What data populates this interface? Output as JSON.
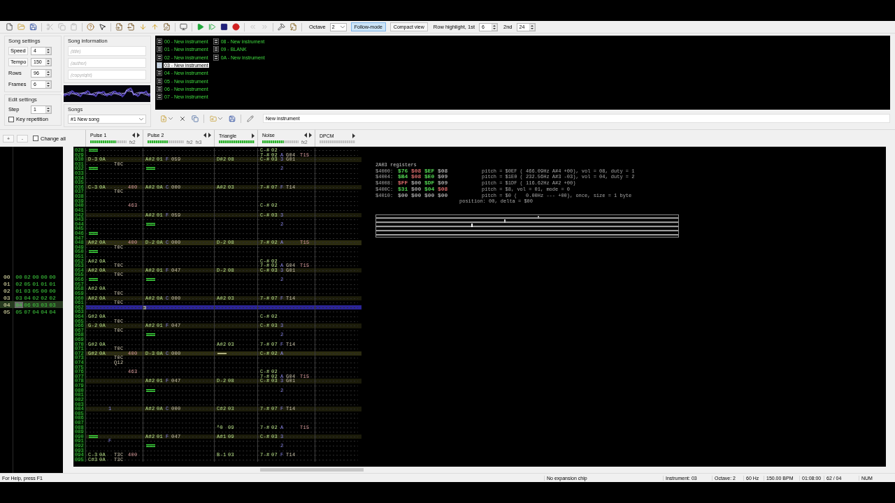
{
  "toolbar": {
    "buttons": [
      {
        "kind": "new",
        "disabled": false
      },
      {
        "kind": "open",
        "disabled": false
      },
      {
        "kind": "save",
        "disabled": false
      },
      {
        "kind": "cut",
        "disabled": true
      },
      {
        "kind": "copy",
        "disabled": true
      },
      {
        "kind": "paste",
        "disabled": true
      },
      {
        "kind": "help",
        "disabled": false
      },
      {
        "kind": "context-help",
        "disabled": false
      },
      {
        "kind": "import",
        "disabled": false
      },
      {
        "kind": "export",
        "disabled": false
      },
      {
        "kind": "move-down",
        "disabled": false
      },
      {
        "kind": "move-up",
        "disabled": false
      },
      {
        "kind": "edit",
        "disabled": false
      },
      {
        "kind": "properties",
        "disabled": false
      },
      {
        "kind": "play",
        "disabled": false
      },
      {
        "kind": "play-pattern",
        "disabled": false
      },
      {
        "kind": "stop",
        "disabled": false
      },
      {
        "kind": "record",
        "disabled": false
      },
      {
        "kind": "previous-song",
        "disabled": true
      },
      {
        "kind": "next-song",
        "disabled": true
      },
      {
        "kind": "settings",
        "disabled": false
      },
      {
        "kind": "nsf",
        "disabled": false
      }
    ],
    "octave_label": "Octave",
    "octave": "2",
    "follow_mode": {
      "label": "Follow-mode",
      "on": true
    },
    "compact_view": {
      "label": "Compact view",
      "on": false
    },
    "row_highlight_label": "Row highlight, 1st",
    "row_highlight_1st": "6",
    "second_label": "2nd",
    "row_highlight_2nd": "24"
  },
  "song_settings": {
    "title": "Song settings",
    "fields": [
      {
        "label": "Speed",
        "kind": "button",
        "value": "4"
      },
      {
        "label": "Tempo",
        "kind": "button",
        "value": "150"
      },
      {
        "label": "Rows",
        "kind": "label",
        "value": "96"
      },
      {
        "label": "Frames",
        "kind": "label",
        "value": "6"
      }
    ]
  },
  "edit_settings": {
    "title": "Edit settings",
    "step_label": "Step",
    "step": "1",
    "key_repetition": {
      "label": "Key repetition",
      "checked": false
    }
  },
  "song_information": {
    "title": "Song information",
    "fields": [
      {
        "placeholder": "(title)"
      },
      {
        "placeholder": "(author)"
      },
      {
        "placeholder": "(copyright)"
      }
    ]
  },
  "songs": {
    "title": "Songs",
    "value": "#1 New song"
  },
  "instruments": [
    {
      "label": "00 - New instrument",
      "selected": false
    },
    {
      "label": "01 - New instrument",
      "selected": false
    },
    {
      "label": "02 - New instrument",
      "selected": false
    },
    {
      "label": "03 - New instrument",
      "selected": true
    },
    {
      "label": "04 - New instrument",
      "selected": false
    },
    {
      "label": "05 - New instrument",
      "selected": false
    },
    {
      "label": "06 - New instrument",
      "selected": false
    },
    {
      "label": "07 - New instrument",
      "selected": false
    },
    {
      "label": "08 - New instrument",
      "selected": false
    },
    {
      "label": "09 - BLANK",
      "selected": false
    },
    {
      "label": "0A - New instrument",
      "selected": false
    }
  ],
  "instrument_toolbar": {
    "buttons": [
      {
        "kind": "new",
        "has_menu": true
      },
      {
        "kind": "remove",
        "has_menu": false
      },
      {
        "kind": "clone",
        "has_menu": false
      },
      {
        "kind": "load",
        "has_menu": true
      },
      {
        "kind": "save",
        "has_menu": false
      },
      {
        "kind": "edit",
        "has_menu": false
      }
    ],
    "name": "New instrument"
  },
  "frame_controls": {
    "add": "+",
    "remove": "-",
    "change_all": {
      "label": "Change all",
      "checked": false
    }
  },
  "frames": [
    {
      "number": "00",
      "patterns": [
        "00",
        "02",
        "00",
        "00",
        "00"
      ],
      "selected": false
    },
    {
      "number": "01",
      "patterns": [
        "02",
        "05",
        "01",
        "01",
        "01"
      ],
      "selected": false
    },
    {
      "number": "02",
      "patterns": [
        "01",
        "03",
        "05",
        "00",
        "00"
      ],
      "selected": false
    },
    {
      "number": "03",
      "patterns": [
        "03",
        "04",
        "02",
        "02",
        "02"
      ],
      "selected": false
    },
    {
      "number": "04",
      "patterns": [
        "04",
        "06",
        "03",
        "03",
        "03"
      ],
      "selected": true
    },
    {
      "number": "05",
      "patterns": [
        "05",
        "07",
        "04",
        "04",
        "04"
      ],
      "selected": false
    }
  ],
  "channels": [
    {
      "name": "Pulse 1",
      "level": 0.72,
      "fx_labels": [
        "fx2"
      ],
      "kind": "two-arrows"
    },
    {
      "name": "Pulse 2",
      "level": 0.55,
      "fx_labels": [
        "fx2",
        "fx3"
      ],
      "kind": "two-arrows"
    },
    {
      "name": "Triangle",
      "level": 1,
      "kind": "one-arrow"
    },
    {
      "name": "Noise",
      "level": 0.6,
      "fx_labels": [
        "fx2"
      ],
      "kind": "two-arrows"
    },
    {
      "name": "DPCM",
      "kind": "one-arrow"
    }
  ],
  "pattern_rows": [
    {
      "number": "028",
      "selected": false,
      "kind": "plain",
      "cells": [
        {
          "kind": "note-off"
        },
        {
          "kind": "empty"
        },
        {
          "kind": "empty"
        },
        {
          "kind": "entry",
          "note": "C-#",
          "inst": "02"
        }
      ]
    },
    {
      "number": "029",
      "selected": false,
      "kind": "plain",
      "cells": [
        {
          "kind": "empty"
        },
        {
          "kind": "empty"
        },
        {
          "kind": "empty"
        },
        {
          "kind": "entry",
          "note": "7-#",
          "inst": "02",
          "vol": "A",
          "fx1": "G04",
          "fx2": "T15"
        }
      ]
    },
    {
      "number": "030",
      "selected": false,
      "kind": "minor",
      "cells": [
        {
          "kind": "entry",
          "note": "D-3",
          "inst": "0A"
        },
        {
          "kind": "entry",
          "note": "A#2",
          "inst": "01",
          "vol": "F",
          "fx1": "059"
        },
        {
          "kind": "entry",
          "note": "D#2",
          "inst": "08"
        },
        {
          "kind": "entry",
          "note": "C-#",
          "inst": "03",
          "vol": "3",
          "fx1": "G01"
        }
      ]
    },
    {
      "number": "031",
      "selected": false,
      "kind": "plain",
      "cells": [
        {
          "kind": "entry",
          "fx1": "T0C"
        }
      ]
    },
    {
      "number": "032",
      "selected": false,
      "kind": "plain",
      "cells": [
        {
          "kind": "note-off"
        },
        {
          "kind": "note-off"
        },
        {
          "kind": "empty"
        },
        {
          "kind": "entry",
          "vol": "2"
        }
      ]
    },
    {
      "number": "033",
      "selected": false,
      "kind": "plain"
    },
    {
      "number": "034",
      "selected": false,
      "kind": "plain"
    },
    {
      "number": "035",
      "selected": false,
      "kind": "plain"
    },
    {
      "number": "036",
      "selected": false,
      "kind": "minor",
      "cells": [
        {
          "kind": "entry",
          "note": "C-3",
          "inst": "0A",
          "fx2": "400"
        },
        {
          "kind": "entry",
          "note": "A#2",
          "inst": "0A",
          "vol": "C",
          "fx1": "000"
        },
        {
          "kind": "entry",
          "note": "A#2",
          "inst": "03"
        },
        {
          "kind": "entry",
          "note": "7-#",
          "inst": "07",
          "vol": "F",
          "fx1": "T14"
        }
      ]
    },
    {
      "number": "037",
      "selected": false,
      "kind": "plain",
      "cells": [
        {
          "kind": "entry",
          "fx1": "T0C"
        }
      ]
    },
    {
      "number": "038",
      "selected": false,
      "kind": "plain"
    },
    {
      "number": "039",
      "selected": false,
      "kind": "plain"
    },
    {
      "number": "040",
      "selected": false,
      "kind": "plain",
      "cells": [
        {
          "kind": "entry",
          "fx2": "463"
        },
        {
          "kind": "empty"
        },
        {
          "kind": "empty"
        },
        {
          "kind": "entry",
          "note": "C-#",
          "inst": "02"
        }
      ]
    },
    {
      "number": "041",
      "selected": false,
      "kind": "plain"
    },
    {
      "number": "042",
      "selected": false,
      "kind": "minor",
      "cells": [
        {
          "kind": "empty"
        },
        {
          "kind": "entry",
          "note": "A#2",
          "inst": "01",
          "vol": "F",
          "fx1": "059"
        },
        {
          "kind": "empty"
        },
        {
          "kind": "entry",
          "note": "C-#",
          "inst": "03",
          "vol": "3"
        }
      ]
    },
    {
      "number": "043",
      "selected": false,
      "kind": "plain"
    },
    {
      "number": "044",
      "selected": false,
      "kind": "plain",
      "cells": [
        {
          "kind": "empty"
        },
        {
          "kind": "note-off"
        },
        {
          "kind": "empty"
        },
        {
          "kind": "entry",
          "vol": "2"
        }
      ]
    },
    {
      "number": "045",
      "selected": false,
      "kind": "plain"
    },
    {
      "number": "046",
      "selected": false,
      "kind": "plain",
      "cells": [
        {
          "kind": "note-off"
        }
      ]
    },
    {
      "number": "047",
      "selected": false,
      "kind": "plain"
    },
    {
      "number": "048",
      "selected": false,
      "kind": "major",
      "cells": [
        {
          "kind": "entry",
          "note": "A#2",
          "inst": "0A",
          "fx2": "400"
        },
        {
          "kind": "entry",
          "note": "D-2",
          "inst": "0A",
          "vol": "C",
          "fx1": "000"
        },
        {
          "kind": "entry",
          "note": "D-2",
          "inst": "08"
        },
        {
          "kind": "entry",
          "note": "7-#",
          "inst": "02",
          "vol": "A",
          "fx2": "T15"
        }
      ]
    },
    {
      "number": "049",
      "selected": false,
      "kind": "plain",
      "cells": [
        {
          "kind": "entry",
          "fx1": "T0C"
        }
      ]
    },
    {
      "number": "050",
      "selected": false,
      "kind": "plain",
      "cells": [
        {
          "kind": "note-off"
        }
      ]
    },
    {
      "number": "051",
      "selected": false,
      "kind": "plain"
    },
    {
      "number": "052",
      "selected": false,
      "kind": "plain",
      "cells": [
        {
          "kind": "entry",
          "note": "A#2",
          "inst": "0A"
        },
        {
          "kind": "empty"
        },
        {
          "kind": "empty"
        },
        {
          "kind": "entry",
          "note": "C-#",
          "inst": "02"
        }
      ]
    },
    {
      "number": "053",
      "selected": false,
      "kind": "plain",
      "cells": [
        {
          "kind": "entry",
          "fx1": "T0C"
        },
        {
          "kind": "empty"
        },
        {
          "kind": "empty"
        },
        {
          "kind": "entry",
          "note": "7-#",
          "inst": "02",
          "vol": "A",
          "fx1": "G04",
          "fx2": "T15"
        }
      ]
    },
    {
      "number": "054",
      "selected": false,
      "kind": "minor",
      "cells": [
        {
          "kind": "entry",
          "note": "A#2",
          "inst": "0A"
        },
        {
          "kind": "entry",
          "note": "A#2",
          "inst": "01",
          "vol": "F",
          "fx1": "047"
        },
        {
          "kind": "entry",
          "note": "D-2",
          "inst": "08"
        },
        {
          "kind": "entry",
          "note": "C-#",
          "inst": "03",
          "vol": "3",
          "fx1": "G01"
        }
      ]
    },
    {
      "number": "055",
      "selected": false,
      "kind": "plain",
      "cells": [
        {
          "kind": "entry",
          "fx1": "T0C"
        }
      ]
    },
    {
      "number": "056",
      "selected": false,
      "kind": "plain",
      "cells": [
        {
          "kind": "note-off"
        },
        {
          "kind": "note-off"
        },
        {
          "kind": "empty"
        },
        {
          "kind": "entry",
          "vol": "2"
        }
      ]
    },
    {
      "number": "057",
      "selected": false,
      "kind": "plain"
    },
    {
      "number": "058",
      "selected": false,
      "kind": "plain",
      "cells": [
        {
          "kind": "entry",
          "note": "A#2",
          "inst": "0A"
        }
      ]
    },
    {
      "number": "059",
      "selected": false,
      "kind": "plain",
      "cells": [
        {
          "kind": "entry",
          "fx1": "T0C"
        }
      ]
    },
    {
      "number": "060",
      "selected": false,
      "kind": "minor",
      "cells": [
        {
          "kind": "entry",
          "note": "A#2",
          "inst": "0A"
        },
        {
          "kind": "entry",
          "note": "A#2",
          "inst": "0A",
          "vol": "C",
          "fx1": "000"
        },
        {
          "kind": "entry",
          "note": "A#2",
          "inst": "03"
        },
        {
          "kind": "entry",
          "note": "7-#",
          "inst": "07",
          "vol": "F",
          "fx1": "T14"
        }
      ]
    },
    {
      "number": "061",
      "selected": false,
      "kind": "plain",
      "cells": [
        {
          "kind": "entry",
          "fx1": "T0C"
        }
      ]
    },
    {
      "number": "062",
      "selected": true,
      "kind": "plain"
    },
    {
      "number": "063",
      "selected": false,
      "kind": "plain"
    },
    {
      "number": "064",
      "selected": false,
      "kind": "plain",
      "cells": [
        {
          "kind": "entry",
          "note": "G#2",
          "inst": "0A"
        },
        {
          "kind": "empty"
        },
        {
          "kind": "empty"
        },
        {
          "kind": "entry",
          "note": "C-#",
          "inst": "02"
        }
      ]
    },
    {
      "number": "065",
      "selected": false,
      "kind": "plain",
      "cells": [
        {
          "kind": "entry",
          "fx1": "T0C"
        }
      ]
    },
    {
      "number": "066",
      "selected": false,
      "kind": "minor",
      "cells": [
        {
          "kind": "entry",
          "note": "G-2",
          "inst": "0A"
        },
        {
          "kind": "entry",
          "note": "A#2",
          "inst": "01",
          "vol": "F",
          "fx1": "047"
        },
        {
          "kind": "empty"
        },
        {
          "kind": "entry",
          "note": "C-#",
          "inst": "03",
          "vol": "3"
        }
      ]
    },
    {
      "number": "067",
      "selected": false,
      "kind": "plain",
      "cells": [
        {
          "kind": "entry",
          "fx1": "T0C"
        }
      ]
    },
    {
      "number": "068",
      "selected": false,
      "kind": "plain",
      "cells": [
        {
          "kind": "empty"
        },
        {
          "kind": "note-off"
        },
        {
          "kind": "empty"
        },
        {
          "kind": "entry",
          "vol": "2"
        }
      ]
    },
    {
      "number": "069",
      "selected": false,
      "kind": "plain"
    },
    {
      "number": "070",
      "selected": false,
      "kind": "plain",
      "cells": [
        {
          "kind": "entry",
          "note": "G#2",
          "inst": "0A"
        },
        {
          "kind": "empty"
        },
        {
          "kind": "entry",
          "note": "A#2",
          "inst": "03"
        },
        {
          "kind": "entry",
          "note": "7-#",
          "inst": "07",
          "vol": "F",
          "fx1": "T14"
        }
      ]
    },
    {
      "number": "071",
      "selected": false,
      "kind": "plain",
      "cells": [
        {
          "kind": "entry",
          "fx1": "T0C"
        }
      ]
    },
    {
      "number": "072",
      "selected": false,
      "kind": "major",
      "cells": [
        {
          "kind": "entry",
          "note": "G#2",
          "inst": "0A",
          "fx2": "400"
        },
        {
          "kind": "entry",
          "note": "D-3",
          "inst": "0A",
          "vol": "C",
          "fx1": "000"
        },
        {
          "kind": "release"
        },
        {
          "kind": "entry",
          "note": "C-#",
          "inst": "02",
          "vol": "A"
        }
      ]
    },
    {
      "number": "073",
      "selected": false,
      "kind": "plain",
      "cells": [
        {
          "kind": "entry",
          "fx1": "T0C"
        }
      ]
    },
    {
      "number": "074",
      "selected": false,
      "kind": "plain",
      "cells": [
        {
          "kind": "entry",
          "fx1": "Q12"
        }
      ]
    },
    {
      "number": "075",
      "selected": false,
      "kind": "plain"
    },
    {
      "number": "076",
      "selected": false,
      "kind": "plain",
      "cells": [
        {
          "kind": "entry",
          "fx2": "463"
        },
        {
          "kind": "empty"
        },
        {
          "kind": "empty"
        },
        {
          "kind": "entry",
          "note": "C-#",
          "inst": "02"
        }
      ]
    },
    {
      "number": "077",
      "selected": false,
      "kind": "plain",
      "cells": [
        {
          "kind": "empty"
        },
        {
          "kind": "empty"
        },
        {
          "kind": "empty"
        },
        {
          "kind": "entry",
          "note": "7-#",
          "inst": "02",
          "vol": "A",
          "fx1": "G04",
          "fx2": "T15"
        }
      ]
    },
    {
      "number": "078",
      "selected": false,
      "kind": "minor",
      "cells": [
        {
          "kind": "empty"
        },
        {
          "kind": "entry",
          "note": "A#2",
          "inst": "01",
          "vol": "F",
          "fx1": "047"
        },
        {
          "kind": "entry",
          "note": "D-2",
          "inst": "08"
        },
        {
          "kind": "entry",
          "note": "C-#",
          "inst": "03",
          "vol": "3",
          "fx1": "G01"
        }
      ]
    },
    {
      "number": "079",
      "selected": false,
      "kind": "plain"
    },
    {
      "number": "080",
      "selected": false,
      "kind": "plain",
      "cells": [
        {
          "kind": "empty"
        },
        {
          "kind": "note-off"
        },
        {
          "kind": "empty"
        },
        {
          "kind": "entry",
          "vol": "2"
        }
      ]
    },
    {
      "number": "081",
      "selected": false,
      "kind": "plain"
    },
    {
      "number": "082",
      "selected": false,
      "kind": "plain"
    },
    {
      "number": "083",
      "selected": false,
      "kind": "plain"
    },
    {
      "number": "084",
      "selected": false,
      "kind": "minor",
      "cells": [
        {
          "kind": "entry",
          "vol": "1"
        },
        {
          "kind": "entry",
          "note": "A#2",
          "inst": "0A",
          "vol": "C",
          "fx1": "000"
        },
        {
          "kind": "entry",
          "note": "C#2",
          "inst": "03"
        },
        {
          "kind": "entry",
          "note": "7-#",
          "inst": "07",
          "vol": "F",
          "fx1": "T14"
        }
      ]
    },
    {
      "number": "085",
      "selected": false,
      "kind": "plain"
    },
    {
      "number": "086",
      "selected": false,
      "kind": "plain"
    },
    {
      "number": "087",
      "selected": false,
      "kind": "plain"
    },
    {
      "number": "088",
      "selected": false,
      "kind": "plain",
      "cells": [
        {
          "kind": "empty"
        },
        {
          "kind": "empty"
        },
        {
          "kind": "entry",
          "note": "^0",
          "inst": "09"
        },
        {
          "kind": "entry",
          "note": "7-#",
          "inst": "02",
          "vol": "A",
          "fx2": "T15"
        }
      ]
    },
    {
      "number": "089",
      "selected": false,
      "kind": "plain"
    },
    {
      "number": "090",
      "selected": false,
      "kind": "minor",
      "cells": [
        {
          "kind": "note-off"
        },
        {
          "kind": "entry",
          "note": "A#2",
          "inst": "01",
          "vol": "F",
          "fx1": "047"
        },
        {
          "kind": "entry",
          "note": "A#1",
          "inst": "09"
        },
        {
          "kind": "entry",
          "note": "C-#",
          "inst": "03",
          "vol": "3"
        }
      ]
    },
    {
      "number": "091",
      "selected": false,
      "kind": "plain",
      "cells": [
        {
          "kind": "entry",
          "vol": "F"
        }
      ]
    },
    {
      "number": "092",
      "selected": false,
      "kind": "plain",
      "cells": [
        {
          "kind": "empty"
        },
        {
          "kind": "note-off"
        },
        {
          "kind": "empty"
        },
        {
          "kind": "entry",
          "vol": "2"
        }
      ]
    },
    {
      "number": "093",
      "selected": false,
      "kind": "plain"
    },
    {
      "number": "094",
      "selected": false,
      "kind": "plain",
      "cells": [
        {
          "kind": "entry",
          "note": "C-3",
          "inst": "0A",
          "fx1": "T3C",
          "fx2": "400"
        },
        {
          "kind": "empty"
        },
        {
          "kind": "entry",
          "note": "B-1",
          "inst": "03"
        },
        {
          "kind": "entry",
          "note": "7-#",
          "inst": "07",
          "vol": "F",
          "fx1": "T14"
        }
      ]
    },
    {
      "number": "095",
      "selected": false,
      "kind": "plain",
      "cells": [
        {
          "kind": "entry",
          "note": "C#3",
          "inst": "0A",
          "fx1": "T3C"
        }
      ]
    }
  ],
  "registers": {
    "title": "2A03 registers",
    "rows": [
      {
        "address": "$4000:",
        "bytes": [
          {
            "text": "$76",
            "color": "#52d452"
          },
          {
            "text": "$08",
            "color": "#d86a6a"
          },
          {
            "text": "$EF",
            "color": "#52d452"
          },
          {
            "text": "$08",
            "color": "#a8a8a8"
          }
        ],
        "info": "pitch = $0EF ( 466.09Hz A#4 +00), vol = 08, duty = 1"
      },
      {
        "address": "$4004:",
        "bytes": [
          {
            "text": "$B4",
            "color": "#52d452"
          },
          {
            "text": "$08",
            "color": "#d86a6a"
          },
          {
            "text": "$E0",
            "color": "#52d452"
          },
          {
            "text": "$09",
            "color": "#a8a8a8"
          }
        ],
        "info": "pitch = $1E0 ( 232.56Hz A#3 -03), vol = 04, duty = 2"
      },
      {
        "address": "$4008:",
        "bytes": [
          {
            "text": "$FF",
            "color": "#d86a6a"
          },
          {
            "text": "$00",
            "color": "#a8a8a8"
          },
          {
            "text": "$DF",
            "color": "#52d452"
          },
          {
            "text": "$09",
            "color": "#a8a8a8"
          }
        ],
        "info": "pitch = $1DF ( 116.62Hz A#2 +00)"
      },
      {
        "address": "$400C:",
        "bytes": [
          {
            "text": "$31",
            "color": "#52d452"
          },
          {
            "text": "$00",
            "color": "#a8a8a8"
          },
          {
            "text": "$04",
            "color": "#52d452"
          },
          {
            "text": "$08",
            "color": "#d86a6a"
          }
        ],
        "info": "pitch = $8, vol = 01, mode = 0"
      },
      {
        "address": "$4010:",
        "bytes": [
          {
            "text": "$00",
            "color": "#a8a8a8"
          },
          {
            "text": "$00",
            "color": "#a8a8a8"
          },
          {
            "text": "$00",
            "color": "#a8a8a8"
          },
          {
            "text": "$00",
            "color": "#a8a8a8"
          }
        ],
        "info": "pitch = $0 (   0.00Hz --- +00), once, size = 1 byte"
      }
    ],
    "extra_line": "position: 00, delta = $00"
  },
  "status_bar": {
    "help": "For Help, press F1",
    "chip": "No expansion chip",
    "instrument": "Instrument: 03",
    "octave": "Octave: 2",
    "rate": "60 Hz",
    "tempo": "150.00 BPM",
    "time": "01:08:00",
    "position": "62 / 04",
    "num": "NUM"
  }
}
